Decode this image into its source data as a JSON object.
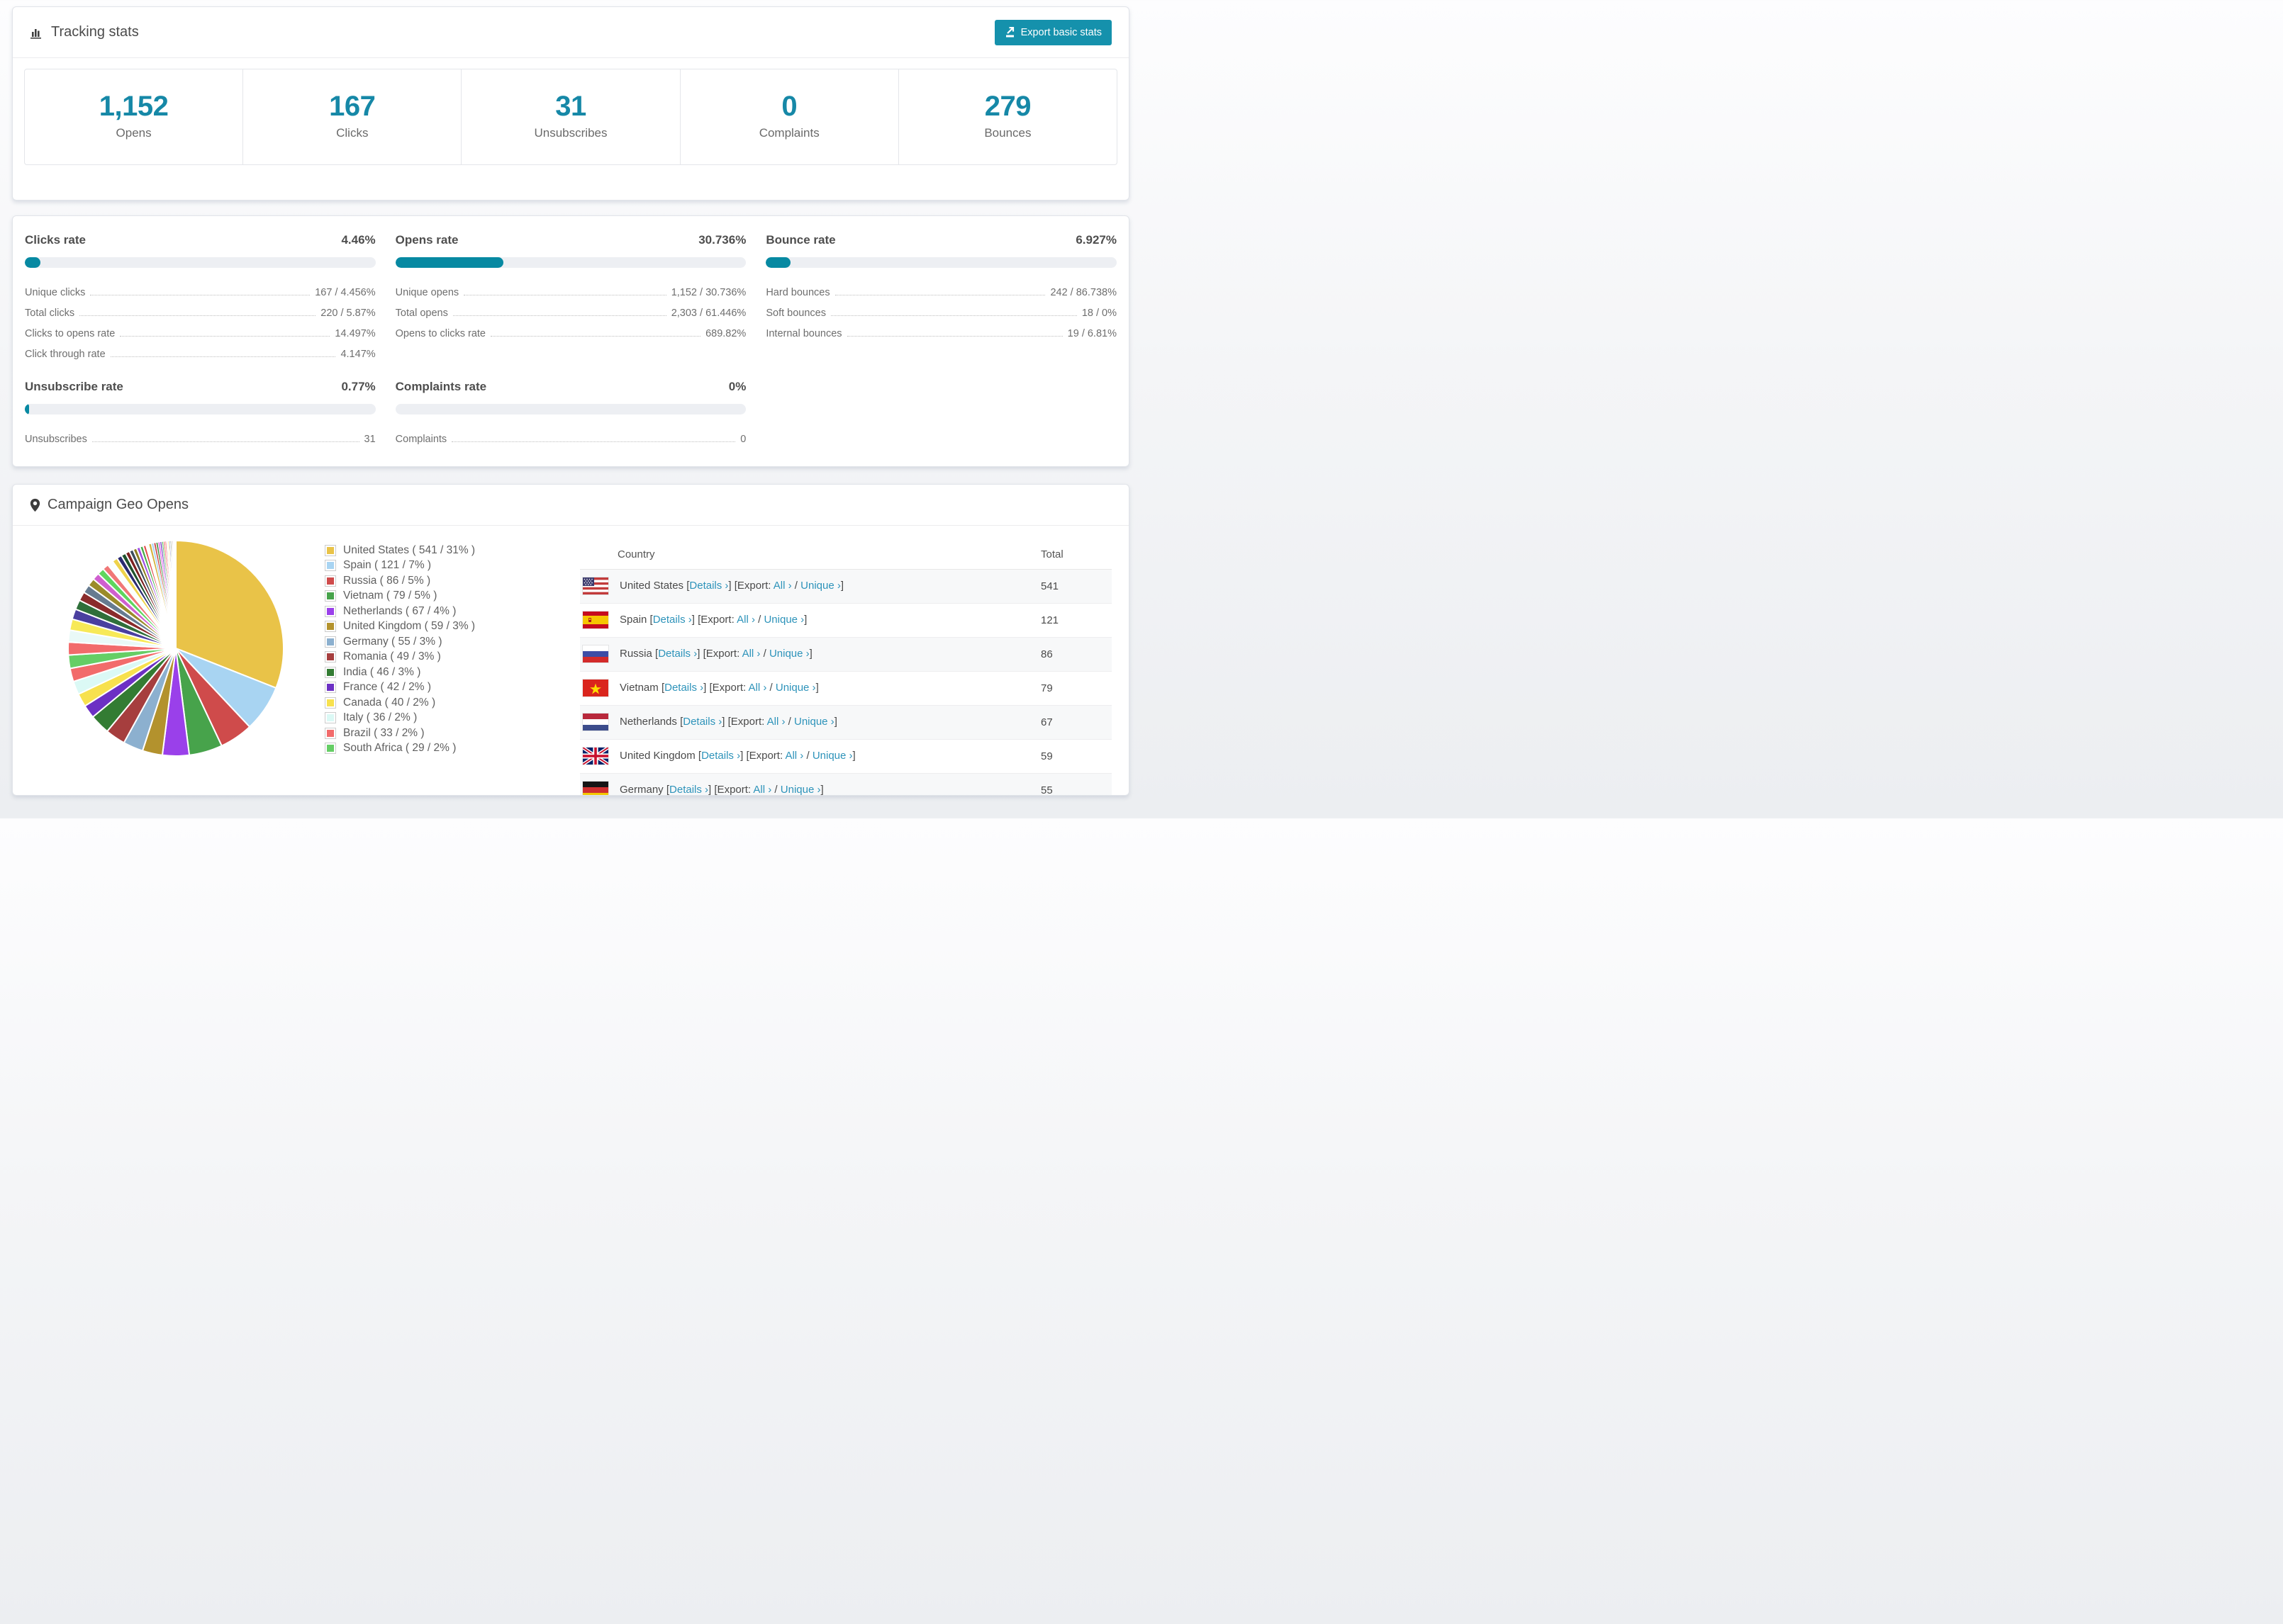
{
  "colors": {
    "accent_teal": "#0789a2",
    "number_teal": "#1688a7",
    "button_teal": "#1591ac",
    "link_teal": "#2d93ba"
  },
  "tracking": {
    "title": "Tracking stats",
    "export_label": "Export basic stats",
    "stats": [
      {
        "value": "1,152",
        "label": "Opens"
      },
      {
        "value": "167",
        "label": "Clicks"
      },
      {
        "value": "31",
        "label": "Unsubscribes"
      },
      {
        "value": "0",
        "label": "Complaints"
      },
      {
        "value": "279",
        "label": "Bounces"
      }
    ]
  },
  "rates": {
    "panels": [
      {
        "title": "Clicks rate",
        "value": "4.46%",
        "pct": 4.46,
        "rows": [
          {
            "label": "Unique clicks",
            "value": "167 / 4.456%"
          },
          {
            "label": "Total clicks",
            "value": "220 / 5.87%"
          },
          {
            "label": "Clicks to opens rate",
            "value": "14.497%"
          },
          {
            "label": "Click through rate",
            "value": "4.147%"
          }
        ]
      },
      {
        "title": "Opens rate",
        "value": "30.736%",
        "pct": 30.736,
        "rows": [
          {
            "label": "Unique opens",
            "value": "1,152 / 30.736%"
          },
          {
            "label": "Total opens",
            "value": "2,303 / 61.446%"
          },
          {
            "label": "Opens to clicks rate",
            "value": "689.82%"
          }
        ]
      },
      {
        "title": "Bounce rate",
        "value": "6.927%",
        "pct": 6.927,
        "rows": [
          {
            "label": "Hard bounces",
            "value": "242 / 86.738%"
          },
          {
            "label": "Soft bounces",
            "value": "18 / 0%"
          },
          {
            "label": "Internal bounces",
            "value": "19 / 6.81%"
          }
        ]
      },
      {
        "title": "Unsubscribe rate",
        "value": "0.77%",
        "pct": 0.77,
        "rows": [
          {
            "label": "Unsubscribes",
            "value": "31"
          }
        ]
      },
      {
        "title": "Complaints rate",
        "value": "0%",
        "pct": 0,
        "rows": [
          {
            "label": "Complaints",
            "value": "0"
          }
        ]
      }
    ]
  },
  "geo": {
    "title": "Campaign Geo Opens",
    "link_labels": {
      "details": "Details ›",
      "export_prefix": "[Export:",
      "all": "All ›",
      "slash": "/",
      "unique": "Unique ›",
      "open": "[",
      "close": "]"
    },
    "table": {
      "headers": [
        "Country",
        "Total"
      ],
      "rows": [
        {
          "country": "United States",
          "flag": "us",
          "total": "541"
        },
        {
          "country": "Spain",
          "flag": "es",
          "total": "121"
        },
        {
          "country": "Russia",
          "flag": "ru",
          "total": "86"
        },
        {
          "country": "Vietnam",
          "flag": "vn",
          "total": "79"
        },
        {
          "country": "Netherlands",
          "flag": "nl",
          "total": "67"
        },
        {
          "country": "United Kingdom",
          "flag": "gb",
          "total": "59"
        },
        {
          "country": "Germany",
          "flag": "de",
          "total": "55"
        }
      ]
    }
  },
  "chart_data": {
    "type": "pie",
    "title": "Campaign Geo Opens",
    "unit": "opens",
    "start_angle_deg": -90,
    "direction": "clockwise",
    "legend_position": "right-of-pie",
    "slices": [
      {
        "label": "United States",
        "value": 541,
        "pct": 31,
        "color": "#e9c348"
      },
      {
        "label": "Spain",
        "value": 121,
        "pct": 7,
        "color": "#a8d4f2"
      },
      {
        "label": "Russia",
        "value": 86,
        "pct": 5,
        "color": "#cf4b4b"
      },
      {
        "label": "Vietnam",
        "value": 79,
        "pct": 5,
        "color": "#47a34b"
      },
      {
        "label": "Netherlands",
        "value": 67,
        "pct": 4,
        "color": "#9a40ea"
      },
      {
        "label": "United Kingdom",
        "value": 59,
        "pct": 3,
        "color": "#b3922d"
      },
      {
        "label": "Germany",
        "value": 55,
        "pct": 3,
        "color": "#8cb0cf"
      },
      {
        "label": "Romania",
        "value": 49,
        "pct": 3,
        "color": "#a63e3e"
      },
      {
        "label": "India",
        "value": 46,
        "pct": 3,
        "color": "#337c33"
      },
      {
        "label": "France",
        "value": 42,
        "pct": 2,
        "color": "#6c30c4"
      },
      {
        "label": "Canada",
        "value": 40,
        "pct": 2,
        "color": "#f7e14e"
      },
      {
        "label": "Italy",
        "value": 36,
        "pct": 2,
        "color": "#dbf9f5"
      },
      {
        "label": "Brazil",
        "value": 33,
        "pct": 2,
        "color": "#f26b6b"
      },
      {
        "label": "South Africa",
        "value": 29,
        "pct": 2,
        "color": "#65ce65"
      }
    ],
    "others": {
      "pct": 26,
      "note": "many small unlabeled country slices",
      "slice_count": 40,
      "palette": [
        "#f26b6b",
        "#e9f9f7",
        "#f7e957",
        "#4a3f9f",
        "#2f6f3a",
        "#8a2b2b",
        "#667b90",
        "#9b8b2a",
        "#cf5fcf",
        "#5ed65e",
        "#f07777",
        "#fafffe",
        "#eed34b",
        "#2b2b70",
        "#1f512b",
        "#7c2020",
        "#3c4c5c",
        "#8d7d20",
        "#9d4be4",
        "#47ab47",
        "#e34d4d",
        "#fffef2",
        "#d6b23c",
        "#a9d2f2",
        "#cd4848",
        "#3f8f3f",
        "#e75ce7",
        "#6b36c3",
        "#58c058",
        "#ef5959"
      ]
    }
  }
}
